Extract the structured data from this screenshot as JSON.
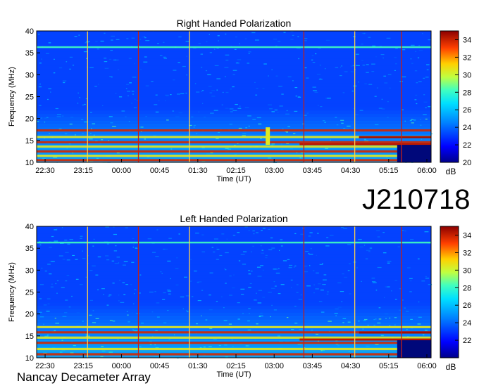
{
  "observation_id": "J210718",
  "instrument": "Nancay Decameter Array",
  "palette": [
    "#00008b",
    "#0000ff",
    "#0060ff",
    "#00c0ff",
    "#40ffc0",
    "#c0ff40",
    "#ffd000",
    "#ff6000",
    "#c00000",
    "#7a0000"
  ],
  "chart_data": [
    {
      "type": "heatmap",
      "title": "Right Handed Polarization",
      "xlabel": "Time (UT)",
      "ylabel": "Frequency (MHz)",
      "x_ticks": [
        "22:30",
        "23:15",
        "00:00",
        "00:45",
        "01:30",
        "02:15",
        "03:00",
        "03:45",
        "04:30",
        "05:15",
        "06:00"
      ],
      "x_range": [
        "22:20",
        "06:05"
      ],
      "y_ticks": [
        10,
        15,
        20,
        25,
        30,
        35,
        40
      ],
      "ylim": [
        10,
        40
      ],
      "colorbar": {
        "label": "dB",
        "ticks": [
          20,
          22,
          24,
          26,
          28,
          30,
          32,
          34
        ],
        "range": [
          20,
          35
        ]
      },
      "horizontal_bands_mhz": [
        10.5,
        11.5,
        12.5,
        13.6,
        14.6,
        15.8,
        17.3,
        36.3
      ],
      "vertical_lines_ut": [
        "23:20",
        "00:20",
        "01:20",
        "03:35",
        "04:35",
        "05:30"
      ],
      "notable_feature": "burst near 02:50-03:00 around 14-18 MHz"
    },
    {
      "type": "heatmap",
      "title": "Left Handed Polarization",
      "xlabel": "Time (UT)",
      "ylabel": "Frequency (MHz)",
      "x_ticks": [
        "22:30",
        "23:15",
        "00:00",
        "00:45",
        "01:30",
        "02:15",
        "03:00",
        "03:45",
        "04:30",
        "05:15",
        "06:00"
      ],
      "x_range": [
        "22:20",
        "06:05"
      ],
      "y_ticks": [
        10,
        15,
        20,
        25,
        30,
        35,
        40
      ],
      "ylim": [
        10,
        40
      ],
      "colorbar": {
        "label": "dB",
        "ticks": [
          22,
          24,
          26,
          28,
          30,
          32,
          34
        ],
        "range": [
          20,
          35
        ]
      },
      "horizontal_bands_mhz": [
        10.8,
        12.0,
        13.4,
        14.6,
        15.8,
        17.0,
        36.3
      ],
      "vertical_lines_ut": [
        "23:20",
        "00:20",
        "01:20",
        "03:35",
        "04:35",
        "05:30"
      ]
    }
  ]
}
